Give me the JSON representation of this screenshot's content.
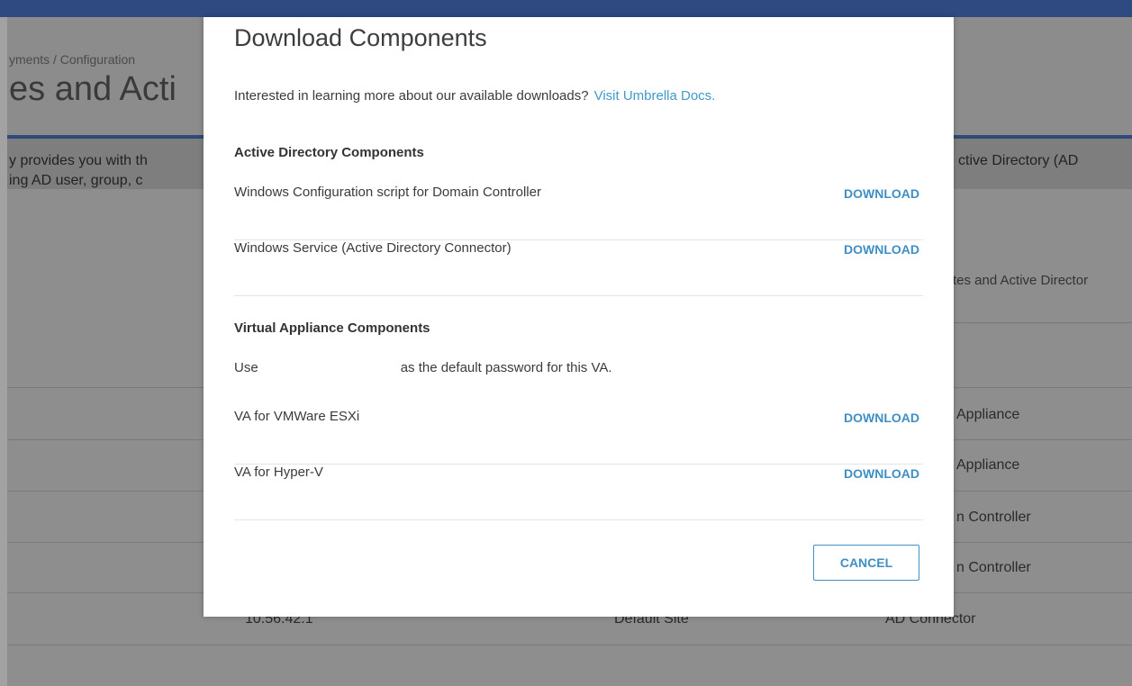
{
  "background": {
    "breadcrumb": "yments / Configuration",
    "title": "es and Acti",
    "banner_line1": "y provides you with th",
    "banner_line2": "ing AD user, group, c",
    "banner_right": "ctive Directory (AD",
    "tab_label": "tes and Active Director",
    "rows": [
      {
        "right": "Appliance"
      },
      {
        "right": "Appliance"
      },
      {
        "right": "n Controller"
      },
      {
        "right": "n Controller"
      },
      {
        "left": "10.56.42.1",
        "middle": "Default Site",
        "right": "AD Connector"
      }
    ]
  },
  "modal": {
    "title": "Download Components",
    "intro_text": "Interested in learning more about our available downloads?",
    "intro_link": "Visit Umbrella Docs.",
    "ad_section": {
      "heading": "Active Directory Components",
      "items": [
        {
          "label": "Windows Configuration script for Domain Controller",
          "action": "DOWNLOAD"
        },
        {
          "label": "Windows Service (Active Directory Connector)",
          "action": "DOWNLOAD"
        }
      ]
    },
    "va_section": {
      "heading": "Virtual Appliance Components",
      "password_prefix": "Use",
      "password_suffix": "as the default password for this VA.",
      "items": [
        {
          "label": "VA for VMWare ESXi",
          "action": "DOWNLOAD"
        },
        {
          "label": "VA for Hyper-V",
          "action": "DOWNLOAD"
        }
      ]
    },
    "cancel_label": "CANCEL"
  },
  "colors": {
    "accent": "#3f8fc4",
    "topbar": "#2e4a80",
    "overlay": "#8c8c8c"
  }
}
